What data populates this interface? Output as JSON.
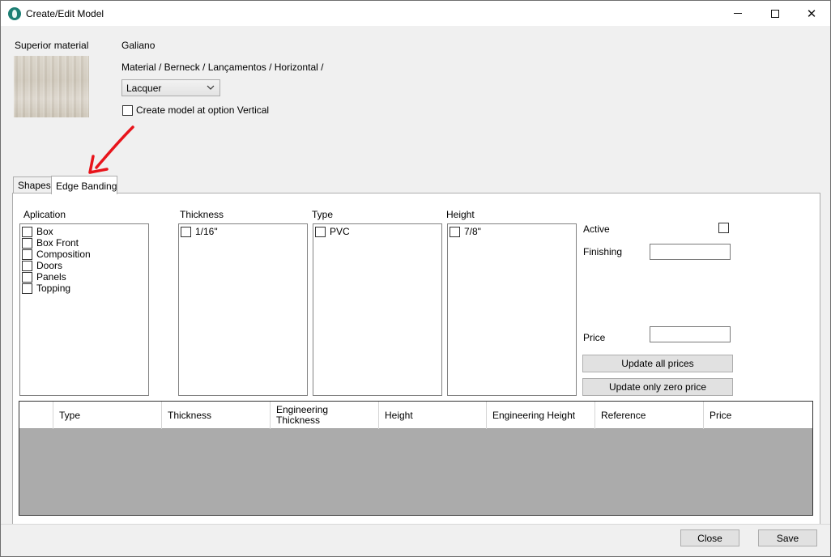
{
  "window": {
    "title": "Create/Edit Model",
    "minimize": "minimize",
    "maximize": "maximize",
    "close_glyph": "✕"
  },
  "header": {
    "superior_material_label": "Superior material",
    "material_name": "Galiano",
    "material_path": "Material / Berneck / Lançamentos / Horizontal /",
    "finish_select": {
      "value": "Lacquer"
    },
    "vertical_option": {
      "label": "Create model at option Vertical",
      "checked": false
    }
  },
  "tabs": [
    {
      "label": "Shapes",
      "active": false
    },
    {
      "label": "Edge Banding",
      "active": true
    }
  ],
  "edge_banding": {
    "application": {
      "label": "Aplication",
      "items": [
        "Box",
        "Box Front",
        "Composition",
        "Doors",
        "Panels",
        "Topping"
      ]
    },
    "thickness": {
      "label": "Thickness",
      "items": [
        "1/16\""
      ]
    },
    "type": {
      "label": "Type",
      "items": [
        "PVC"
      ]
    },
    "height": {
      "label": "Height",
      "items": [
        "7/8\""
      ]
    },
    "active_label": "Active",
    "finishing_label": "Finishing",
    "finishing_value": "",
    "price_label": "Price",
    "price_value": "",
    "update_all_prices": "Update all prices",
    "update_zero_price": "Update only zero price"
  },
  "grid": {
    "columns": [
      "Type",
      "Thickness",
      "Engineering Thickness",
      "Height",
      "Engineering Height",
      "Reference",
      "Price"
    ],
    "rows": []
  },
  "footer": {
    "close_label": "Close",
    "save_label": "Save"
  },
  "colors": {
    "annotation_arrow": "#e8141b",
    "grid_background": "#ababab",
    "window_background": "#f0f0f0"
  }
}
